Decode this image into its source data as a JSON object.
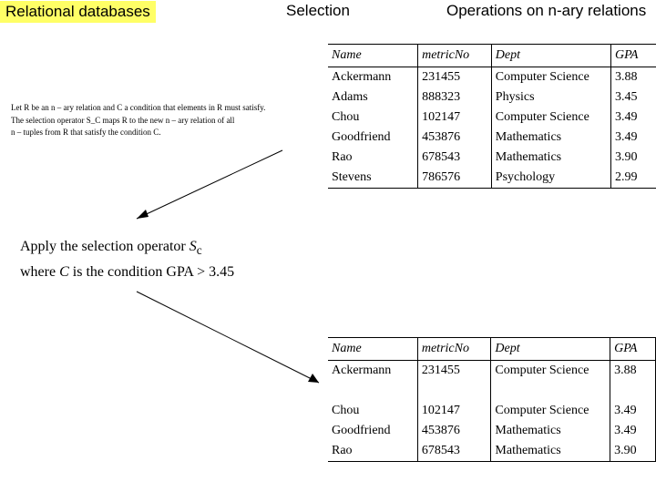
{
  "header": {
    "topic": "Relational databases",
    "title": "Selection",
    "subtitle": "Operations on n-ary relations"
  },
  "definition": {
    "line1": "Let R be an n – ary relation and C a condition that elements in R must satisfy.",
    "line2": "The selection operator S_C maps R to the new n – ary relation of all",
    "line3": "n – tuples from R that satisfy the condition C."
  },
  "apply": {
    "line1_a": "Apply the",
    "line1_b": "selection operator ",
    "line1_c": "S",
    "line1_d": "c",
    "line2_a": "where ",
    "line2_b": "C",
    "line2_c": " is the condition GPA > 3.45"
  },
  "columns": {
    "c1": "Name",
    "c2": "metricNo",
    "c3": "Dept",
    "c4": "GPA"
  },
  "table1": [
    {
      "name": "Ackermann",
      "metric": "231455",
      "dept": "Computer Science",
      "gpa": "3.88"
    },
    {
      "name": "Adams",
      "metric": "888323",
      "dept": "Physics",
      "gpa": "3.45"
    },
    {
      "name": "Chou",
      "metric": "102147",
      "dept": "Computer Science",
      "gpa": "3.49"
    },
    {
      "name": "Goodfriend",
      "metric": "453876",
      "dept": "Mathematics",
      "gpa": "3.49"
    },
    {
      "name": "Rao",
      "metric": "678543",
      "dept": "Mathematics",
      "gpa": "3.90"
    },
    {
      "name": "Stevens",
      "metric": "786576",
      "dept": "Psychology",
      "gpa": "2.99"
    }
  ],
  "table2": [
    {
      "name": "Ackermann",
      "metric": "231455",
      "dept": "Computer Science",
      "gpa": "3.88"
    },
    {
      "name": "Chou",
      "metric": "102147",
      "dept": "Computer Science",
      "gpa": "3.49"
    },
    {
      "name": "Goodfriend",
      "metric": "453876",
      "dept": "Mathematics",
      "gpa": "3.49"
    },
    {
      "name": "Rao",
      "metric": "678543",
      "dept": "Mathematics",
      "gpa": "3.90"
    }
  ]
}
